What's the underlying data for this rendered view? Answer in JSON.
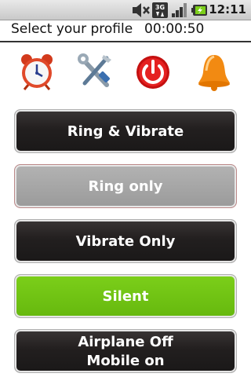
{
  "status_bar": {
    "time": "12:11",
    "icons": [
      "volume-muted-icon",
      "3g-icon",
      "signal-icon",
      "battery-charging-icon"
    ]
  },
  "header": {
    "title": "Select your profile",
    "timer": "00:00:50"
  },
  "tools": [
    {
      "name": "alarm-clock-icon"
    },
    {
      "name": "tools-settings-icon"
    },
    {
      "name": "power-icon"
    },
    {
      "name": "bell-icon"
    }
  ],
  "profiles": [
    {
      "label": "Ring & Vibrate",
      "style": "dark"
    },
    {
      "label": "Ring only",
      "style": "gray"
    },
    {
      "label": "Vibrate Only",
      "style": "dark"
    },
    {
      "label": "Silent",
      "style": "green"
    },
    {
      "label": "Airplane Off\nMobile on",
      "style": "dark"
    }
  ],
  "colors": {
    "active_green": "#6cc014",
    "dark_button": "#221f1f",
    "disabled_gray": "#a3a3a3"
  }
}
